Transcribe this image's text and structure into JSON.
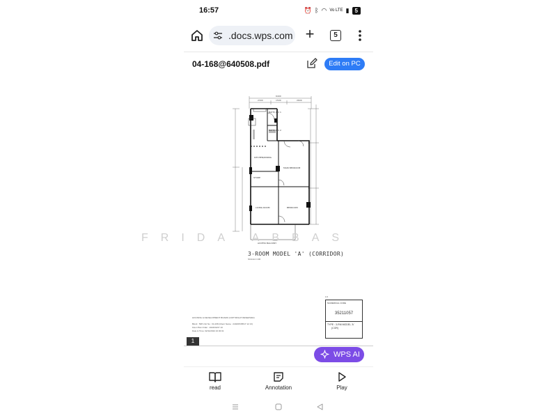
{
  "status_bar": {
    "time": "16:57",
    "battery": "5",
    "network": "Vo LTE"
  },
  "browser": {
    "url": ".docs.wps.com",
    "tab_count": "5",
    "new_tab_symbol": "+"
  },
  "document": {
    "filename": "04-168@640508.pdf",
    "edit_on_pc_label": "Edit on PC",
    "page_number": "1",
    "wps_ai_label": "WPS AI"
  },
  "floor_plan": {
    "caption": "3-ROOM MODEL 'A' (CORRIDOR)",
    "scale": "SCALE 1:100",
    "rooms": {
      "bath_1": "BATH/ WC 1",
      "bath_2": "BATH/ WC 2",
      "kitchen": "KITCHEN/DINING",
      "master_bedroom": "MAIN BEDROOM",
      "store": "STORE",
      "living_room": "LIVING ROOM",
      "bedroom": "BEDROOM",
      "balcony": "ACCESS BALCONY"
    },
    "dimensions": {
      "overall": "6400",
      "top_a": "2300",
      "top_b": "1500",
      "top_c": "2600",
      "store_w": "1800"
    }
  },
  "footer": {
    "line1": "HOUSING & DEVELOPMENT BOARD  (COPYRIGHT RESERVED)",
    "line2": "Block : 508   Unit No : 04-168   (Client Name : 240208 80517 12 13)",
    "line3": "Floor Plan Order : 2024/02/27 10",
    "line4": "Date & Time: 02/11/2024  10:30:31"
  },
  "title_block": {
    "top_label": "1/1",
    "label": "NUMERICAL CODE",
    "code": "35211057",
    "type_line1": "TYPE : 3-RM MODEL 'A'",
    "type_line2": "(COR)"
  },
  "watermark": "FRIDA ABBAS",
  "toolbar": {
    "read": "read",
    "annotation": "Annotation",
    "play": "Play"
  },
  "colors": {
    "accent": "#2e7cf6",
    "ai": "#7c4ce6"
  },
  "icons": [
    "home-icon",
    "site-settings-icon",
    "menu-icon",
    "edit-icon",
    "sparkle-icon",
    "book-icon",
    "note-icon",
    "play-icon"
  ]
}
